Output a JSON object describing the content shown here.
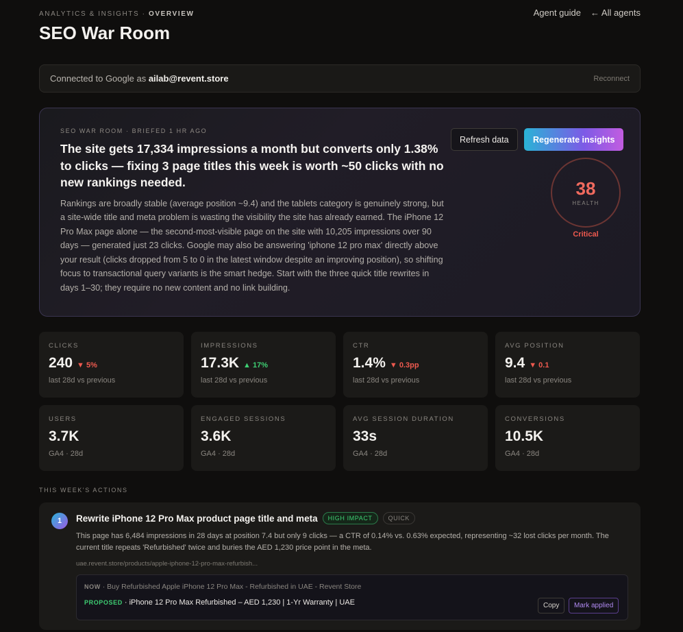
{
  "header": {
    "breadcrumb_section": "ANALYTICS & INSIGHTS",
    "breadcrumb_sep": " · ",
    "breadcrumb_page": "OVERVIEW",
    "title": "SEO War Room",
    "links": {
      "guide": "Agent guide",
      "all_agents": "← All agents"
    }
  },
  "connection": {
    "prefix": "Connected to Google as ",
    "email": "ailab@revent.store",
    "reconnect": "Reconnect"
  },
  "brief": {
    "meta": "SEO WAR ROOM · BRIEFED 1 HR AGO",
    "headline": "The site gets 17,334 impressions a month but converts only 1.38% to clicks — fixing 3 page titles this week is worth ~50 clicks with no new rankings needed.",
    "body": "Rankings are broadly stable (average position ~9.4) and the tablets category is genuinely strong, but a site-wide title and meta problem is wasting the visibility the site has already earned. The iPhone 12 Pro Max page alone — the second-most-visible page on the site with 10,205 impressions over 90 days — generated just 23 clicks. Google may also be answering 'iphone 12 pro max' directly above your result (clicks dropped from 5 to 0 in the latest window despite an improving position), so shifting focus to transactional query variants is the smart hedge. Start with the three quick title rewrites in days 1–30; they require no new content and no link building.",
    "refresh_label": "Refresh data",
    "regenerate_label": "Regenerate insights",
    "health_score": "38",
    "health_label": "HEALTH",
    "health_status": "Critical",
    "colors": {
      "critical": "#ef5a4f"
    }
  },
  "metrics": [
    {
      "label": "CLICKS",
      "value": "240",
      "delta": "▼ 5%",
      "dir": "down",
      "sub": "last 28d vs previous"
    },
    {
      "label": "IMPRESSIONS",
      "value": "17.3K",
      "delta": "▲ 17%",
      "dir": "up",
      "sub": "last 28d vs previous"
    },
    {
      "label": "CTR",
      "value": "1.4%",
      "delta": "▼ 0.3pp",
      "dir": "down",
      "sub": "last 28d vs previous"
    },
    {
      "label": "AVG POSITION",
      "value": "9.4",
      "delta": "▼ 0.1",
      "dir": "down",
      "sub": "last 28d vs previous"
    },
    {
      "label": "USERS",
      "value": "3.7K",
      "delta": "",
      "dir": "",
      "sub": "GA4 · 28d"
    },
    {
      "label": "ENGAGED SESSIONS",
      "value": "3.6K",
      "delta": "",
      "dir": "",
      "sub": "GA4 · 28d"
    },
    {
      "label": "AVG SESSION DURATION",
      "value": "33s",
      "delta": "",
      "dir": "",
      "sub": "GA4 · 28d"
    },
    {
      "label": "CONVERSIONS",
      "value": "10.5K",
      "delta": "",
      "dir": "",
      "sub": "GA4 · 28d"
    }
  ],
  "actions_section": "THIS WEEK'S ACTIONS",
  "actions": [
    {
      "number": "1",
      "title": "Rewrite iPhone 12 Pro Max product page title and meta",
      "impact": "HIGH IMPACT",
      "effort": "QUICK",
      "description": "This page has 6,484 impressions in 28 days at position 7.4 but only 9 clicks — a CTR of 0.14% vs. 0.63% expected, representing ~32 lost clicks per month. The current title repeats 'Refurbished' twice and buries the AED 1,230 price point in the meta.",
      "url": "uae.revent.store/products/apple-iphone-12-pro-max-refurbish...",
      "now_label": "NOW",
      "now_text": " · Buy Refurbished Apple iPhone 12 Pro Max - Refurbished in UAE - Revent Store",
      "proposed_label": "PROPOSED",
      "proposed_text": " · iPhone 12 Pro Max Refurbished – AED 1,230 | 1-Yr Warranty | UAE",
      "copy_label": "Copy",
      "mark_label": "Mark applied"
    }
  ]
}
